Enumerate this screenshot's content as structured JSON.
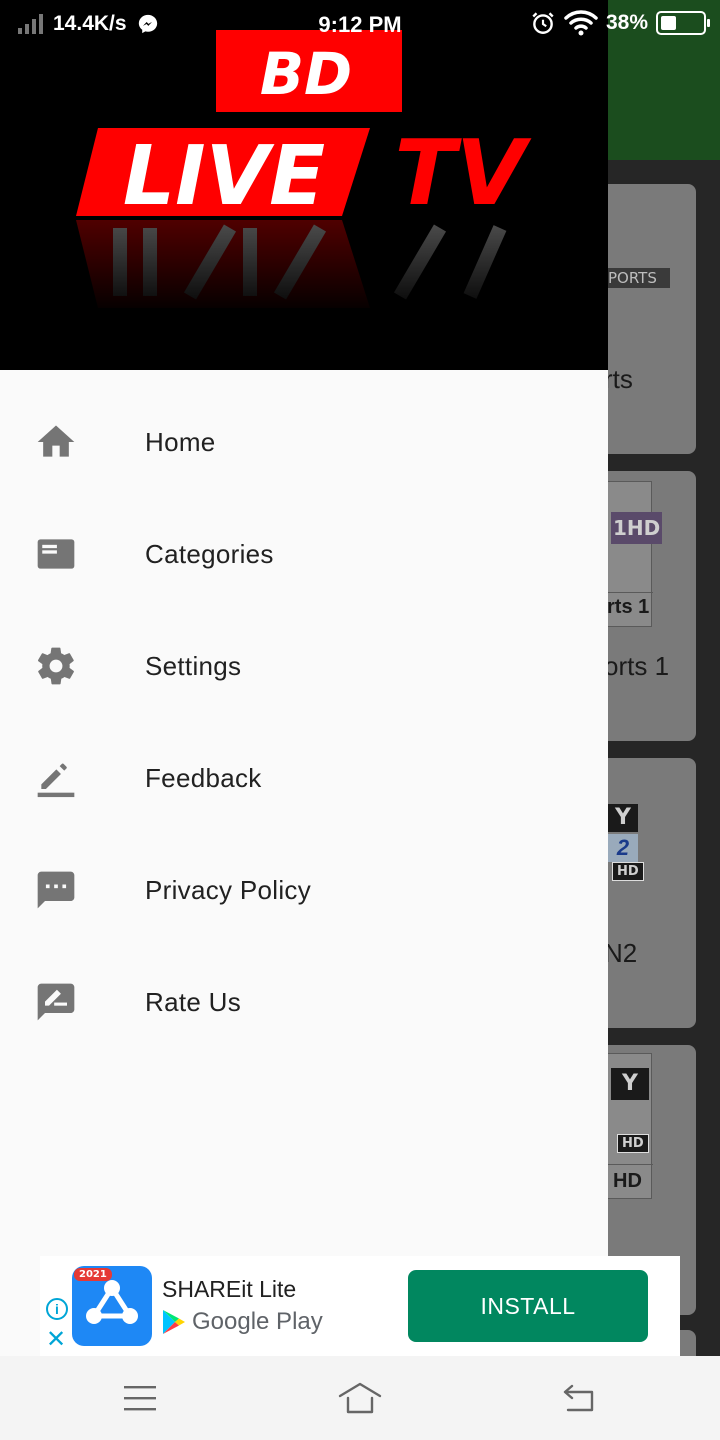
{
  "status_bar": {
    "net_speed": "14.4K/s",
    "time": "9:12 PM",
    "battery": "38%",
    "battery_level": 0.38,
    "icons": [
      "signal-icon",
      "messenger-icon",
      "alarm-icon",
      "wifi-icon",
      "battery-icon"
    ]
  },
  "drawer": {
    "logo": {
      "badge_text": "BD",
      "main_text": "LIVE",
      "accent_text": "TV",
      "colors": {
        "red": "#ff0000",
        "black": "#000000",
        "white": "#ffffff"
      }
    },
    "menu": [
      {
        "label": "Home",
        "icon": "home-icon"
      },
      {
        "label": "Categories",
        "icon": "categories-icon"
      },
      {
        "label": "Settings",
        "icon": "gear-icon"
      },
      {
        "label": "Feedback",
        "icon": "edit-icon"
      },
      {
        "label": "Privacy Policy",
        "icon": "message-icon"
      },
      {
        "label": "Rate Us",
        "icon": "rate-icon"
      }
    ]
  },
  "background": {
    "toolbar_color": "#1b4d1e",
    "cards": [
      {
        "logo_text": "PORTS",
        "name": "rts"
      },
      {
        "logo_text": "1HD",
        "logo_sub": "rts 1",
        "name": "orts 1"
      },
      {
        "logo_text": "Y",
        "logo_num": "2",
        "badge": "HD",
        "name": "N2"
      },
      {
        "logo_text": "Y",
        "badge": "HD",
        "logo_sub": "HD",
        "name": ""
      }
    ]
  },
  "ad": {
    "year_badge": "2021",
    "app_name": "SHAREit Lite",
    "store_name": "Google Play",
    "install_label": "INSTALL",
    "info_label": "i",
    "close_label": "✕",
    "button_color": "#01875f"
  },
  "nav_bar": {
    "buttons": [
      "menu-icon",
      "home-icon",
      "back-icon"
    ]
  }
}
